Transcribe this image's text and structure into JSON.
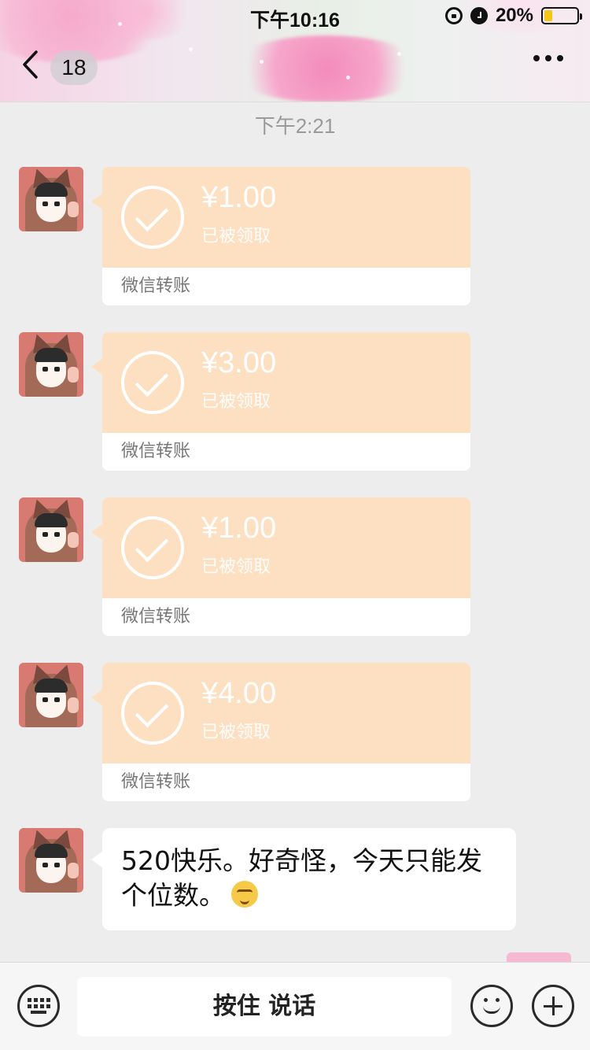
{
  "status_bar": {
    "time": "下午10:16",
    "battery": "20%",
    "icons": [
      "rotation-lock-icon",
      "alarm-icon",
      "battery-icon"
    ]
  },
  "nav": {
    "unread_count": "18",
    "icons": [
      "back-chevron-icon",
      "more-dots-icon"
    ]
  },
  "chat": {
    "timestamp": "下午2:21",
    "transfers": [
      {
        "amount": "¥1.00",
        "status": "已被领取",
        "label": "微信转账"
      },
      {
        "amount": "¥3.00",
        "status": "已被领取",
        "label": "微信转账"
      },
      {
        "amount": "¥1.00",
        "status": "已被领取",
        "label": "微信转账"
      },
      {
        "amount": "¥4.00",
        "status": "已被领取",
        "label": "微信转账"
      }
    ],
    "text_message": "520快乐。好奇怪，今天只能发个位数。",
    "emoji": "laughing-crying-emoji-icon"
  },
  "input_bar": {
    "hold_to_talk": "按住 说话",
    "icons": [
      "keyboard-icon",
      "emoji-icon",
      "plus-icon"
    ]
  },
  "colors": {
    "transfer_received": "#fde0c2",
    "background": "#ededed"
  }
}
